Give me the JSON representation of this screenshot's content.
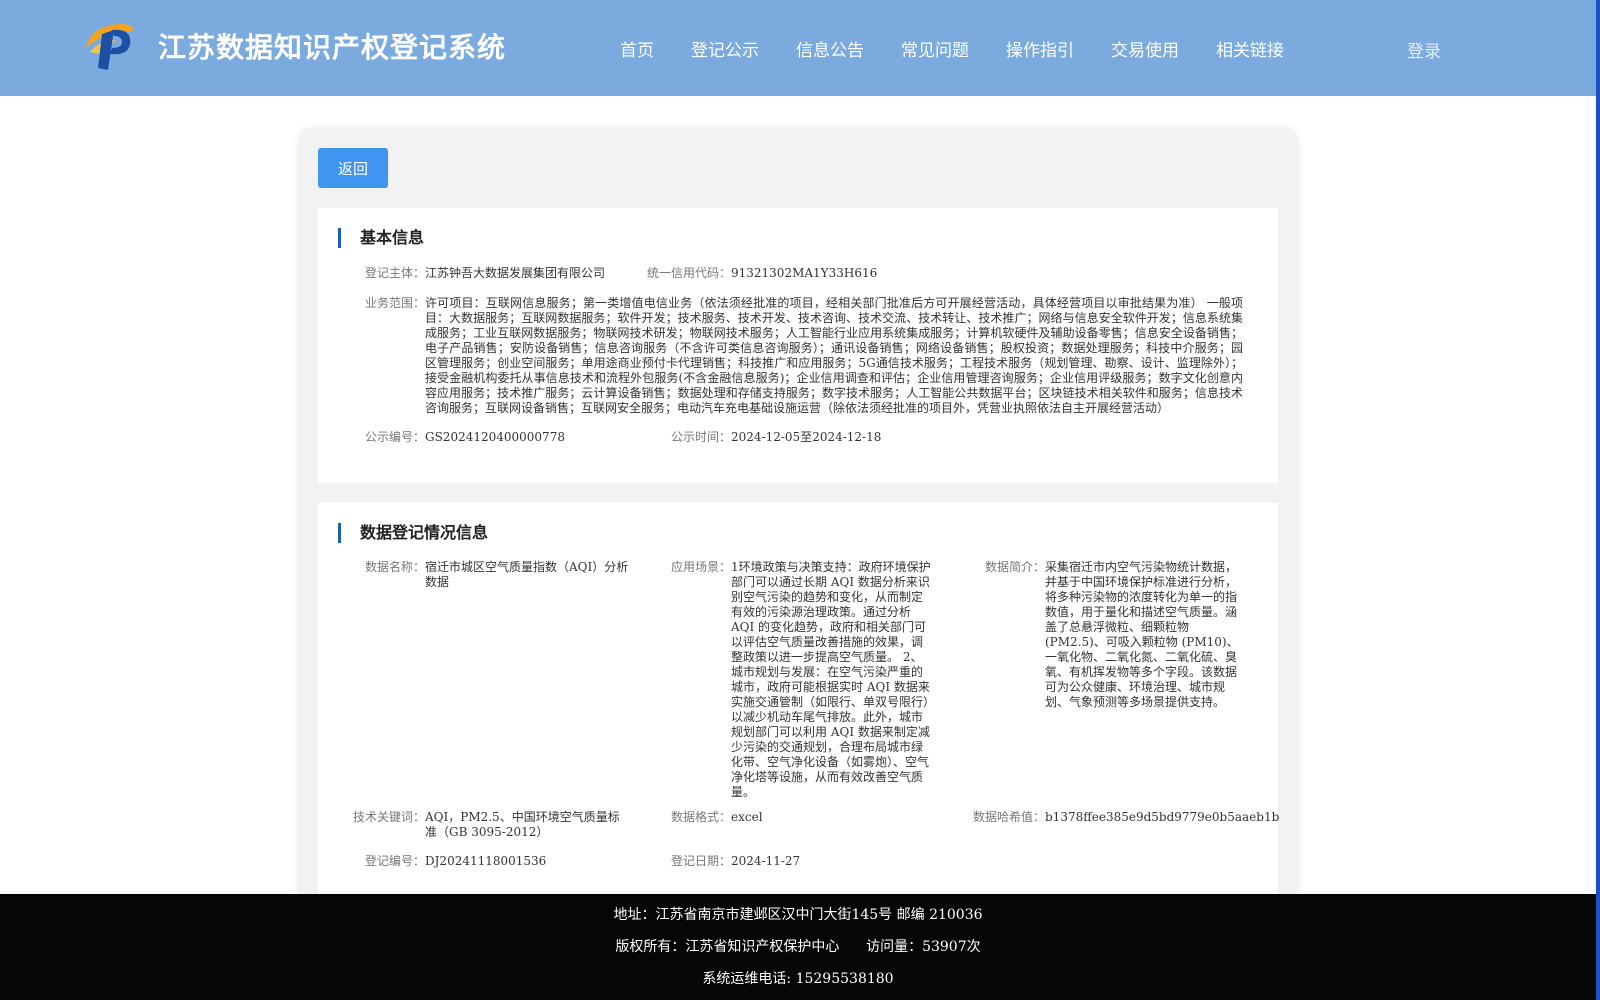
{
  "header": {
    "title": "江苏数据知识产权登记系统",
    "nav": [
      "首页",
      "登记公示",
      "信息公告",
      "常见问题",
      "操作指引",
      "交易使用",
      "相关链接"
    ],
    "login": "登录"
  },
  "colors": {
    "header_bg": "#7aaade",
    "button_bg": "#3f95f0",
    "accent_bar": "#1d5fb0",
    "footer_bg": "#060606"
  },
  "back_button": "返回",
  "basic_info": {
    "title": "基本信息",
    "subject_label": "登记主体：",
    "subject_value": "江苏钟吾大数据发展集团有限公司",
    "credit_code_label": "统一信用代码：",
    "credit_code_value": "91321302MA1Y33H616",
    "business_scope_label": "业务范围：",
    "business_scope_value": "许可项目：互联网信息服务；第一类增值电信业务（依法须经批准的项目，经相关部门批准后方可开展经营活动，具体经营项目以审批结果为准） 一般项目：大数据服务；互联网数据服务；软件开发；技术服务、技术开发、技术咨询、技术交流、技术转让、技术推广；网络与信息安全软件开发；信息系统集成服务；工业互联网数据服务；物联网技术研发；物联网技术服务；人工智能行业应用系统集成服务；计算机软硬件及辅助设备零售；信息安全设备销售；电子产品销售；安防设备销售；信息咨询服务（不含许可类信息咨询服务）；通讯设备销售；网络设备销售；股权投资；数据处理服务；科技中介服务；园区管理服务；创业空间服务；单用途商业预付卡代理销售；科技推广和应用服务；5G通信技术服务；工程技术服务（规划管理、勘察、设计、监理除外）；接受金融机构委托从事信息技术和流程外包服务(不含金融信息服务)；企业信用调查和评估；企业信用管理咨询服务；企业信用评级服务；数字文化创意内容应用服务；技术推广服务；云计算设备销售；数据处理和存储支持服务；数字技术服务；人工智能公共数据平台；区块链技术相关软件和服务；信息技术咨询服务；互联网设备销售；互联网安全服务；电动汽车充电基础设施运营（除依法须经批准的项目外，凭营业执照依法自主开展经营活动）",
    "public_no_label": "公示编号：",
    "public_no_value": "GS2024120400000778",
    "public_time_label": "公示时间：",
    "public_time_value": "2024-12-05至2024-12-18"
  },
  "registration_info": {
    "title": "数据登记情况信息",
    "data_name_label": "数据名称：",
    "data_name_value": "宿迁市城区空气质量指数（AQI）分析数据",
    "scenario_label": "应用场景：",
    "scenario_value": "1环境政策与决策支持：政府环境保护部门可以通过长期 AQI 数据分析来识别空气污染的趋势和变化，从而制定有效的污染源治理政策。通过分析 AQI 的变化趋势，政府和相关部门可以评估空气质量改善措施的效果，调整政策以进一步提高空气质量。 2、城市规划与发展：在空气污染严重的城市，政府可能根据实时 AQI 数据来实施交通管制（如限行、单双号限行）以减少机动车尾气排放。此外，城市规划部门可以利用 AQI 数据来制定减少污染的交通规划，合理布局城市绿化带、空气净化设备（如雾炮）、空气净化塔等设施，从而有效改善空气质量。",
    "intro_label": "数据简介：",
    "intro_value": "采集宿迁市内空气污染物统计数据，并基于中国环境保护标准进行分析，将多种污染物的浓度转化为单一的指数值，用于量化和描述空气质量。涵盖了总悬浮微粒、细颗粒物 (PM2.5)、可吸入颗粒物 (PM10)、一氧化物、二氧化氮、二氧化硫、臭氧、有机挥发物等多个字段。该数据可为公众健康、环境治理、城市规划、气象预测等多场景提供支持。",
    "keywords_label": "技术关键词：",
    "keywords_value": "AQI，PM2.5、中国环境空气质量标准（GB 3095-2012）",
    "format_label": "数据格式：",
    "format_value": "excel",
    "hash_label": "数据哈希值：",
    "hash_value": "b1378ffee385e9d5bd9779e0b5aaeb1b",
    "reg_no_label": "登记编号：",
    "reg_no_value": "DJ20241118001536",
    "reg_date_label": "登记日期：",
    "reg_date_value": "2024-11-27"
  },
  "footer": {
    "address": "地址：江苏省南京市建邺区汉中门大街145号 邮编 210036",
    "copyright": "版权所有：江苏省知识产权保护中心      访问量：53907次",
    "hotline": "系统运维电话: 15295538180"
  }
}
